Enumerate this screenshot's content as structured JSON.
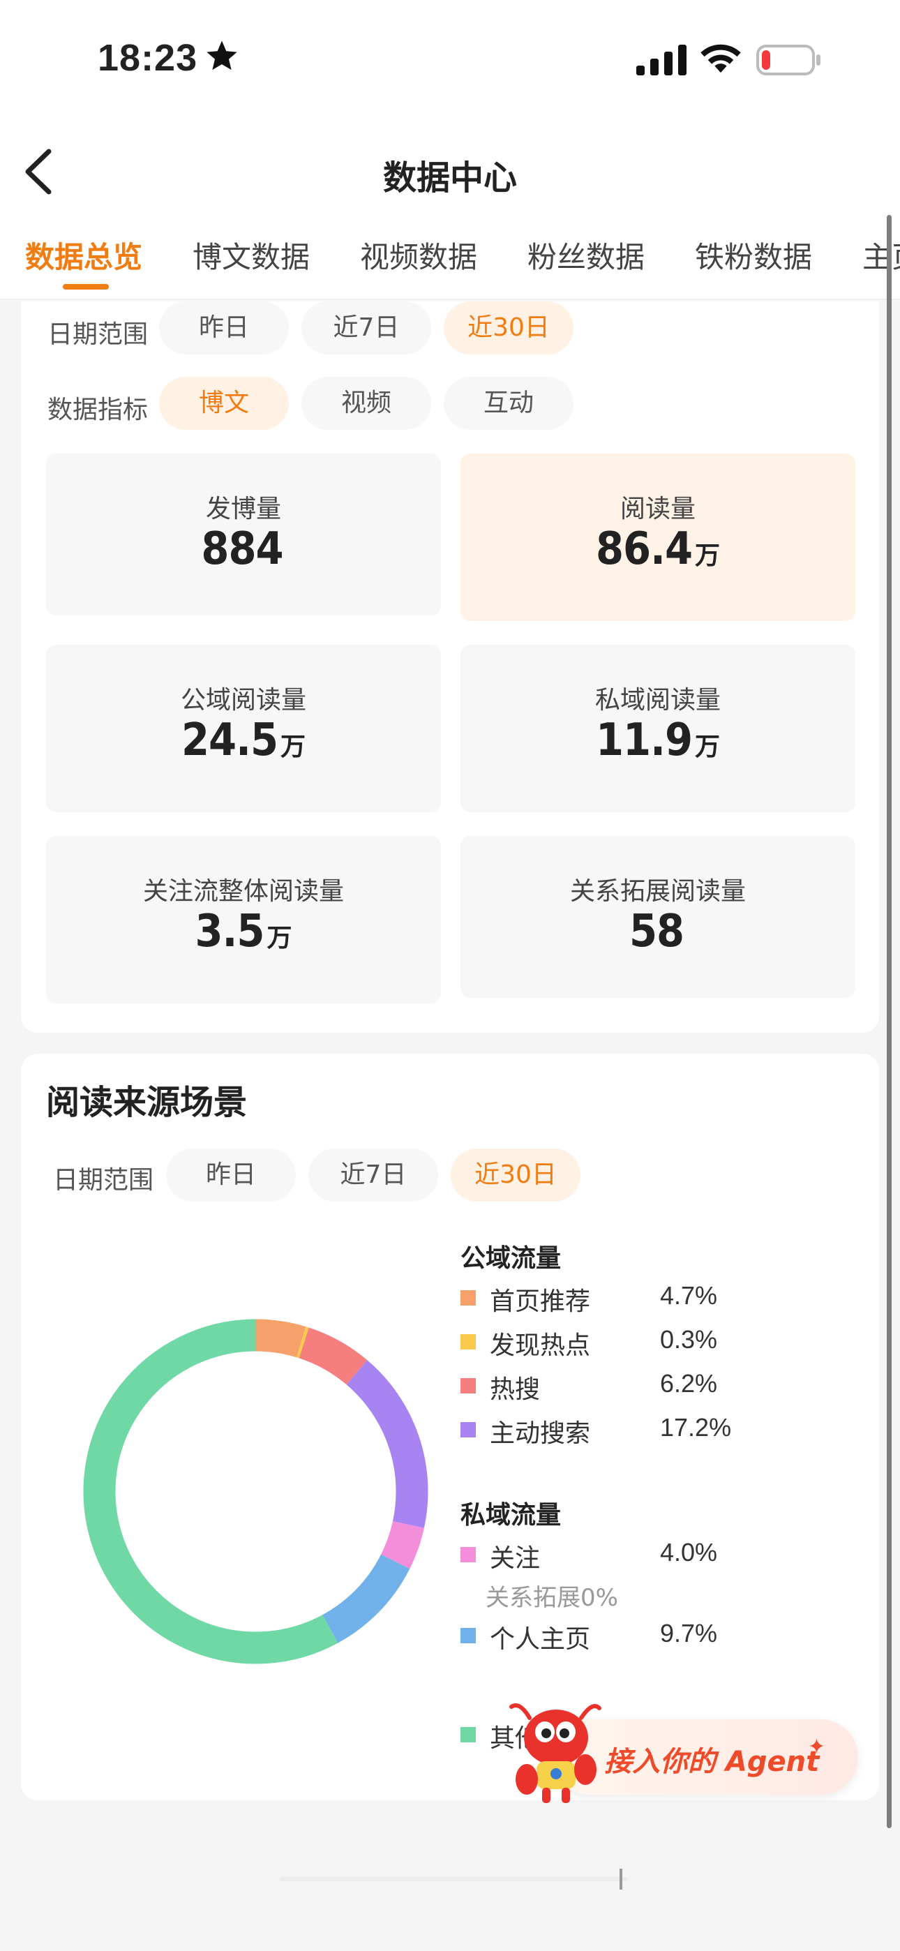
{
  "status_bar": {
    "time": "18:23"
  },
  "nav": {
    "title": "数据中心"
  },
  "tabs": [
    {
      "label": "数据总览",
      "active": true
    },
    {
      "label": "博文数据"
    },
    {
      "label": "视频数据"
    },
    {
      "label": "粉丝数据"
    },
    {
      "label": "铁粉数据"
    },
    {
      "label": "主页"
    }
  ],
  "overview": {
    "date_label": "日期范围",
    "date_options": [
      "昨日",
      "近7日",
      "近30日"
    ],
    "date_selected": "近30日",
    "metric_label": "数据指标",
    "metric_options": [
      "博文",
      "视频",
      "互动"
    ],
    "metric_selected": "博文",
    "stats": [
      {
        "label": "发博量",
        "value": "884",
        "unit": ""
      },
      {
        "label": "阅读量",
        "value": "86.4",
        "unit": "万",
        "active": true
      },
      {
        "label": "公域阅读量",
        "value": "24.5",
        "unit": "万"
      },
      {
        "label": "私域阅读量",
        "value": "11.9",
        "unit": "万"
      },
      {
        "label": "关注流整体阅读量",
        "value": "3.5",
        "unit": "万"
      },
      {
        "label": "关系拓展阅读量",
        "value": "58",
        "unit": ""
      }
    ]
  },
  "sources": {
    "title": "阅读来源场景",
    "date_label": "日期范围",
    "date_options": [
      "昨日",
      "近7日",
      "近30日"
    ],
    "date_selected": "近30日",
    "public_title": "公域流量",
    "public_items": [
      {
        "name": "首页推荐",
        "pct": "4.7%",
        "color": "#f6a06a"
      },
      {
        "name": "发现热点",
        "pct": "0.3%",
        "color": "#f9c94b"
      },
      {
        "name": "热搜",
        "pct": "6.2%",
        "color": "#f57f7f"
      },
      {
        "name": "主动搜索",
        "pct": "17.2%",
        "color": "#a884f2"
      }
    ],
    "private_title": "私域流量",
    "private_items": [
      {
        "name": "关注",
        "pct": "4.0%",
        "color": "#f48edb"
      },
      {
        "name": "个人主页",
        "pct": "9.7%",
        "color": "#6fb1e8"
      }
    ],
    "private_sub": "关系拓展0%",
    "other_item": {
      "name": "其他",
      "color": "#6fd8a4"
    }
  },
  "chart_data": {
    "type": "pie",
    "categories": [
      "首页推荐",
      "发现热点",
      "热搜",
      "主动搜索",
      "关注",
      "个人主页",
      "其他"
    ],
    "values": [
      4.7,
      0.3,
      6.2,
      17.2,
      4.0,
      9.7,
      57.9
    ],
    "colors": [
      "#f6a06a",
      "#f9c94b",
      "#f57f7f",
      "#a884f2",
      "#f48edb",
      "#6fb1e8",
      "#6fd8a4"
    ]
  },
  "agent_button": {
    "label": "接入你的 Agent"
  }
}
